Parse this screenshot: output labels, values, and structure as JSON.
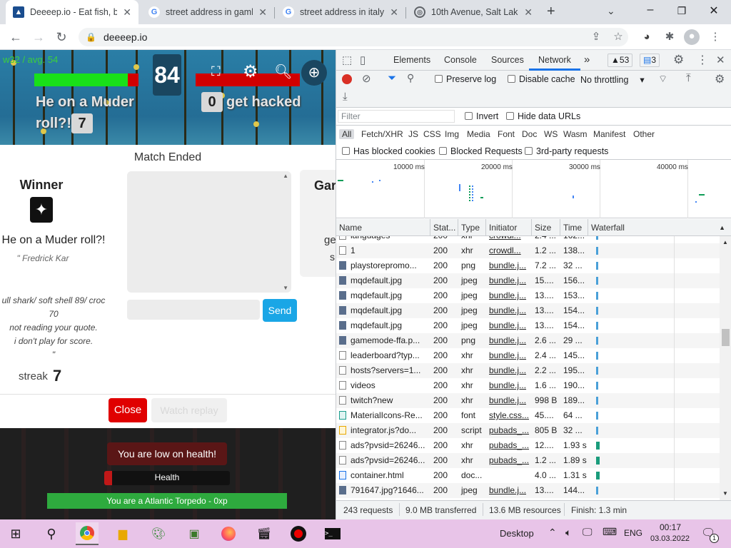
{
  "browser": {
    "tabs": [
      {
        "title": "Deeeep.io - Eat fish, be",
        "active": true
      },
      {
        "title": "street address in gamb",
        "active": false
      },
      {
        "title": "street address in italy -",
        "active": false
      },
      {
        "title": "10th Avenue, Salt Lake",
        "active": false
      }
    ],
    "new_tab": "+",
    "url": "deeeep.io",
    "window_controls": {
      "minimize": "–",
      "maximize": "❐",
      "close": "✕"
    }
  },
  "game": {
    "fps": "w32 / avg. 54",
    "countdown": "84",
    "player_left": "He on a Muder",
    "player_left_2": "roll?!",
    "score_left": "7",
    "score_right": "0",
    "player_right": "get hacked",
    "match_status": "Match Ended",
    "winner_heading": "Winner",
    "winner_name": "He on a Muder roll?!",
    "winner_sub": "\" Fredrick Kar",
    "quote_lines": [
      "ull shark/ soft shell 89/ croc",
      "70",
      "not reading your quote.",
      "i don't play for score.",
      "\""
    ],
    "streak_label": "streak",
    "streak_value": "7",
    "next_card_title": "Gar",
    "next_card_line1": "ge",
    "next_card_line2": "s",
    "send_label": "Send",
    "close_label": "Close",
    "ghost_label": "Watch replay",
    "low_health": "You are low on health!",
    "health_label": "Health",
    "animal_line": "You are a Atlantic Torpedo - 0xp"
  },
  "devtools": {
    "tabs": [
      "Elements",
      "Console",
      "Sources",
      "Network"
    ],
    "active_tab": "Network",
    "more": "»",
    "warnings": "53",
    "messages": "3",
    "preserve_log": "Preserve log",
    "disable_cache": "Disable cache",
    "throttling": "No throttling",
    "filter_placeholder": "Filter",
    "invert": "Invert",
    "hide_data_urls": "Hide data URLs",
    "filter_types": [
      "All",
      "Fetch/XHR",
      "JS",
      "CSS",
      "Img",
      "Media",
      "Font",
      "Doc",
      "WS",
      "Wasm",
      "Manifest",
      "Other"
    ],
    "has_blocked_cookies": "Has blocked cookies",
    "blocked_requests": "Blocked Requests",
    "third_party": "3rd-party requests",
    "timeline_ticks": [
      "10000 ms",
      "20000 ms",
      "30000 ms",
      "40000 ms"
    ],
    "columns": [
      "Name",
      "Stat...",
      "Type",
      "Initiator",
      "Size",
      "Time",
      "Waterfall"
    ],
    "rows": [
      {
        "name": "languages",
        "status": "200",
        "type": "xhr",
        "initiator": "crowdi...",
        "size": "2.4 ...",
        "time": "162...",
        "icon": "doc"
      },
      {
        "name": "1",
        "status": "200",
        "type": "xhr",
        "initiator": "crowdl...",
        "size": "1.2 ...",
        "time": "138...",
        "icon": "doc"
      },
      {
        "name": "playstorepromo...",
        "status": "200",
        "type": "png",
        "initiator": "bundle.j...",
        "size": "7.2 ...",
        "time": "32 ...",
        "icon": "img"
      },
      {
        "name": "mqdefault.jpg",
        "status": "200",
        "type": "jpeg",
        "initiator": "bundle.j...",
        "size": "15....",
        "time": "156...",
        "icon": "img"
      },
      {
        "name": "mqdefault.jpg",
        "status": "200",
        "type": "jpeg",
        "initiator": "bundle.j...",
        "size": "13....",
        "time": "153...",
        "icon": "img"
      },
      {
        "name": "mqdefault.jpg",
        "status": "200",
        "type": "jpeg",
        "initiator": "bundle.j...",
        "size": "13....",
        "time": "154...",
        "icon": "img"
      },
      {
        "name": "mqdefault.jpg",
        "status": "200",
        "type": "jpeg",
        "initiator": "bundle.j...",
        "size": "13....",
        "time": "154...",
        "icon": "img"
      },
      {
        "name": "gamemode-ffa.p...",
        "status": "200",
        "type": "png",
        "initiator": "bundle.j...",
        "size": "2.6 ...",
        "time": "29 ...",
        "icon": "img"
      },
      {
        "name": "leaderboard?typ...",
        "status": "200",
        "type": "xhr",
        "initiator": "bundle.j...",
        "size": "2.4 ...",
        "time": "145...",
        "icon": "doc"
      },
      {
        "name": "hosts?servers=1...",
        "status": "200",
        "type": "xhr",
        "initiator": "bundle.j...",
        "size": "2.2 ...",
        "time": "195...",
        "icon": "doc"
      },
      {
        "name": "videos",
        "status": "200",
        "type": "xhr",
        "initiator": "bundle.j...",
        "size": "1.6 ...",
        "time": "190...",
        "icon": "doc"
      },
      {
        "name": "twitch?new",
        "status": "200",
        "type": "xhr",
        "initiator": "bundle.j...",
        "size": "998 B",
        "time": "189...",
        "icon": "doc"
      },
      {
        "name": "MaterialIcons-Re...",
        "status": "200",
        "type": "font",
        "initiator": "style.css...",
        "size": "45....",
        "time": "64 ...",
        "icon": "font"
      },
      {
        "name": "integrator.js?do...",
        "status": "200",
        "type": "script",
        "initiator": "pubads_...",
        "size": "805 B",
        "time": "32 ...",
        "icon": "script"
      },
      {
        "name": "ads?pvsid=26246...",
        "status": "200",
        "type": "xhr",
        "initiator": "pubads_...",
        "size": "12....",
        "time": "1.93 s",
        "icon": "doc"
      },
      {
        "name": "ads?pvsid=26246...",
        "status": "200",
        "type": "xhr",
        "initiator": "pubads_...",
        "size": "1.2 ...",
        "time": "1.89 s",
        "icon": "doc"
      },
      {
        "name": "container.html",
        "status": "200",
        "type": "doc...",
        "initiator": "",
        "size": "4.0 ...",
        "time": "1.31 s",
        "icon": "html"
      },
      {
        "name": "791647.jpg?1646...",
        "status": "200",
        "type": "jpeg",
        "initiator": "bundle.j...",
        "size": "13....",
        "time": "144...",
        "icon": "img"
      }
    ],
    "summary": {
      "requests": "243 requests",
      "transferred": "9.0 MB transferred",
      "resources": "13.6 MB resources",
      "finish": "Finish: 1.3 min"
    }
  },
  "taskbar": {
    "desktop": "Desktop",
    "lang": "ENG",
    "time": "00:17",
    "date": "03.03.2022",
    "notification_count": "1"
  }
}
